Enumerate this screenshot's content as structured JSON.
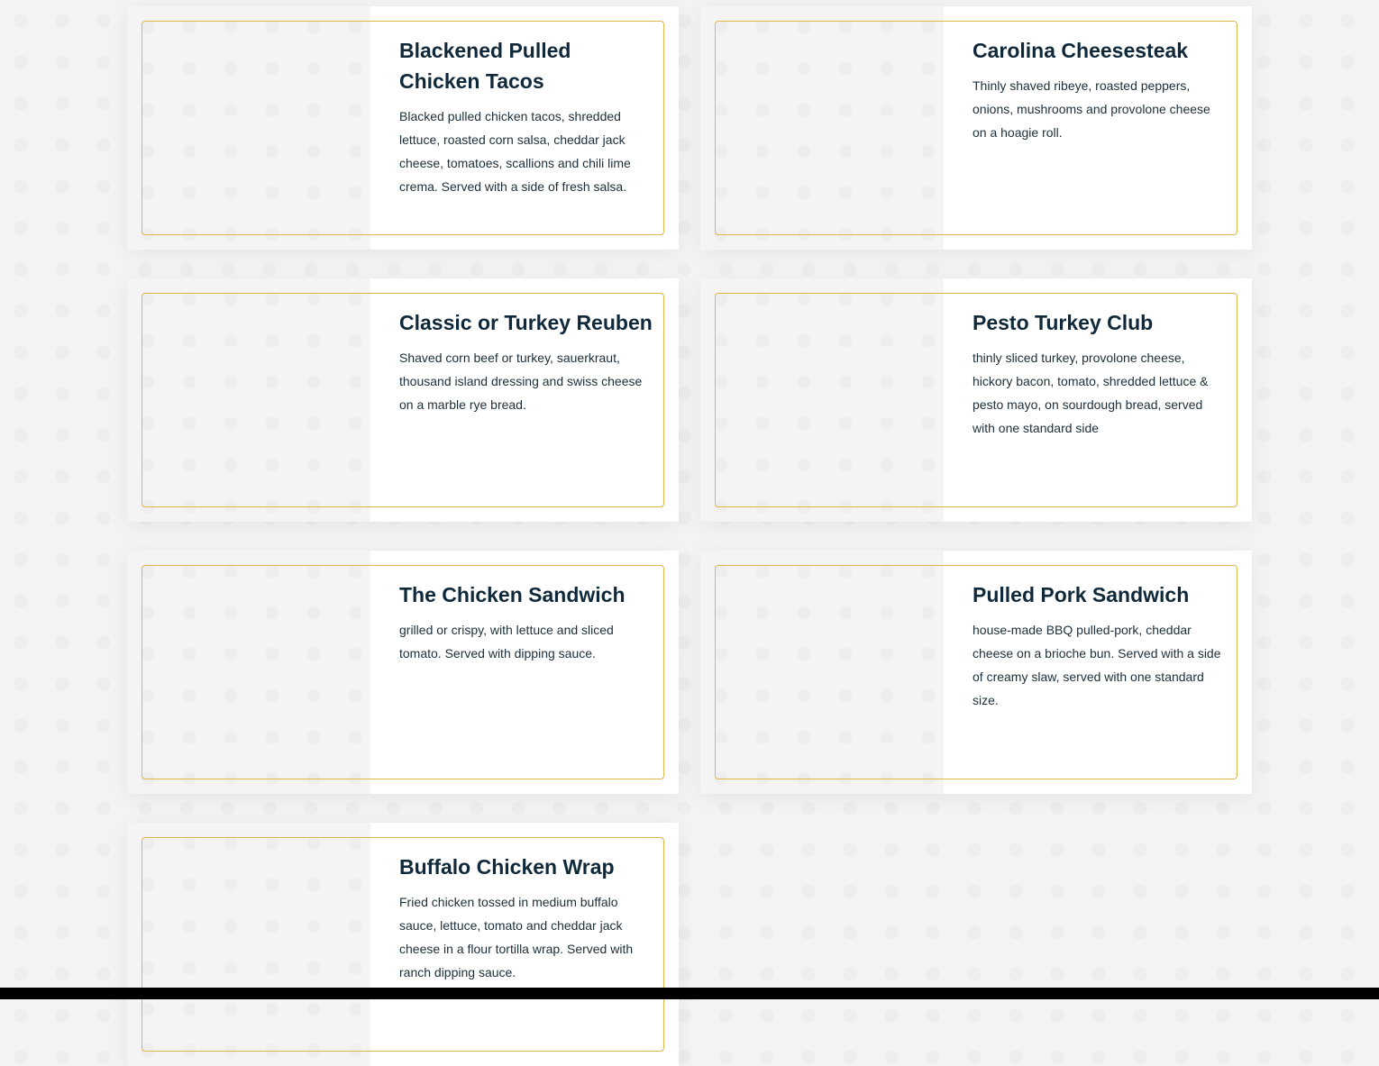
{
  "menu": {
    "items": [
      {
        "name": "Blackened Pulled Chicken Tacos",
        "description": "Blacked pulled chicken tacos, shredded lettuce, roasted corn salsa, cheddar jack cheese, tomatoes, scallions and chili lime crema. Served with a side of fresh salsa."
      },
      {
        "name": "Carolina Cheesesteak",
        "description": "Thinly shaved ribeye, roasted peppers, onions, mushrooms and provolone cheese on a hoagie roll."
      },
      {
        "name": "Classic or Turkey Reuben",
        "description": "Shaved corn beef or turkey, sauerkraut, thousand island dressing and swiss cheese on a marble rye bread."
      },
      {
        "name": "Pesto Turkey Club",
        "description": "thinly sliced turkey, provolone cheese, hickory bacon, tomato, shredded lettuce & pesto mayo, on sourdough bread, served with one standard side"
      },
      {
        "name": "The Chicken Sandwich",
        "description": "grilled or crispy, with lettuce and sliced tomato. Served with dipping sauce."
      },
      {
        "name": "Pulled Pork Sandwich",
        "description": "house-made BBQ pulled-pork, cheddar cheese on a brioche bun. Served with a side of creamy slaw, served with one standard size."
      },
      {
        "name": "Buffalo Chicken Wrap",
        "description": "Fried chicken tossed in medium buffalo sauce, lettuce, tomato and cheddar jack cheese in a flour tortilla wrap. Served with ranch dipping sauce."
      }
    ]
  },
  "colors": {
    "title": "#10293a",
    "text": "#1d2f3a",
    "frame_border": "#e0b54e",
    "card_background": "#ffffff",
    "page_background": "#f3f3f3"
  }
}
